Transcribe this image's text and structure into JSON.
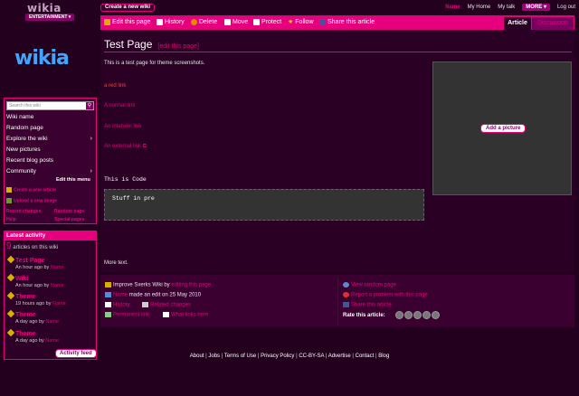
{
  "topbar": {
    "logo": "wikia",
    "hub": "ENTERTAINMENT ▾",
    "create_wiki": "Create a new wiki",
    "user": "Name",
    "my_home": "My Home",
    "my_talk": "My talk",
    "more": "MORE ▾",
    "logout": "Log out"
  },
  "rail": {
    "logo": "wikia",
    "search_placeholder": "Search this wiki",
    "nav": [
      {
        "label": "Wiki name"
      },
      {
        "label": "Random page"
      },
      {
        "label": "Explore the wiki"
      },
      {
        "label": "New pictures"
      },
      {
        "label": "Recent blog posts"
      },
      {
        "label": "Community"
      }
    ],
    "edit_menu": "Edit this menu",
    "tools": {
      "create_article": "Create a new article",
      "upload_image": "Upload a new image",
      "recent_changes": "Recent changes",
      "random_page": "Random page",
      "help": "Help",
      "special_pages": "Special pages"
    }
  },
  "activity": {
    "header": "Latest activity",
    "count": "9",
    "count_label": "articles on this wiki",
    "items": [
      {
        "title": "Test Page",
        "time": "An hour ago by",
        "user": "Name"
      },
      {
        "title": "Wiki",
        "time": "An hour ago by",
        "user": "Name"
      },
      {
        "title": "Theme",
        "time": "19 hours ago by",
        "user": "Name"
      },
      {
        "title": "Theme",
        "time": "A day ago by",
        "user": "Name"
      },
      {
        "title": "Theme",
        "time": "A day ago by",
        "user": "Name"
      }
    ],
    "feed_button": "Activity feed"
  },
  "pagebar": {
    "edit": "Edit this page",
    "history": "History",
    "delete": "Delete",
    "move": "Move",
    "protect": "Protect",
    "follow": "Follow",
    "share": "Share this article",
    "tab_article": "Article",
    "tab_discussion": "Discussion"
  },
  "article": {
    "title": "Test Page",
    "edit_link": "[edit this page]",
    "intro": "This is a test page for theme screenshots.",
    "red_link": "a red link",
    "normal_link": "A normal link",
    "interwiki_link": "An interwiki link",
    "external_link": "An external link",
    "code": "This is Code",
    "pre": "Stuff in pre",
    "add_picture": "Add a picture",
    "more_text": "More text."
  },
  "footer": {
    "improve_prefix": "Improve Sxerks Wiki by",
    "improve_link": "editing this page",
    "editor": "Name",
    "edit_info": "made an edit on 25 May 2010",
    "history": "History",
    "related": "Related changes",
    "permanent": "Permanent link",
    "what_links": "What links here",
    "random": "View random page",
    "report": "Report a problem with this page",
    "share": "Share this article",
    "rate": "Rate this article:"
  },
  "bottom_links": [
    "About",
    "Jobs",
    "Terms of Use",
    "Privacy Policy",
    "CC-BY-SA",
    "Advertise",
    "Contact",
    "Blog"
  ],
  "colors": {
    "accent": "#e6007e",
    "background": "#24001f",
    "panel": "#3a0030"
  }
}
